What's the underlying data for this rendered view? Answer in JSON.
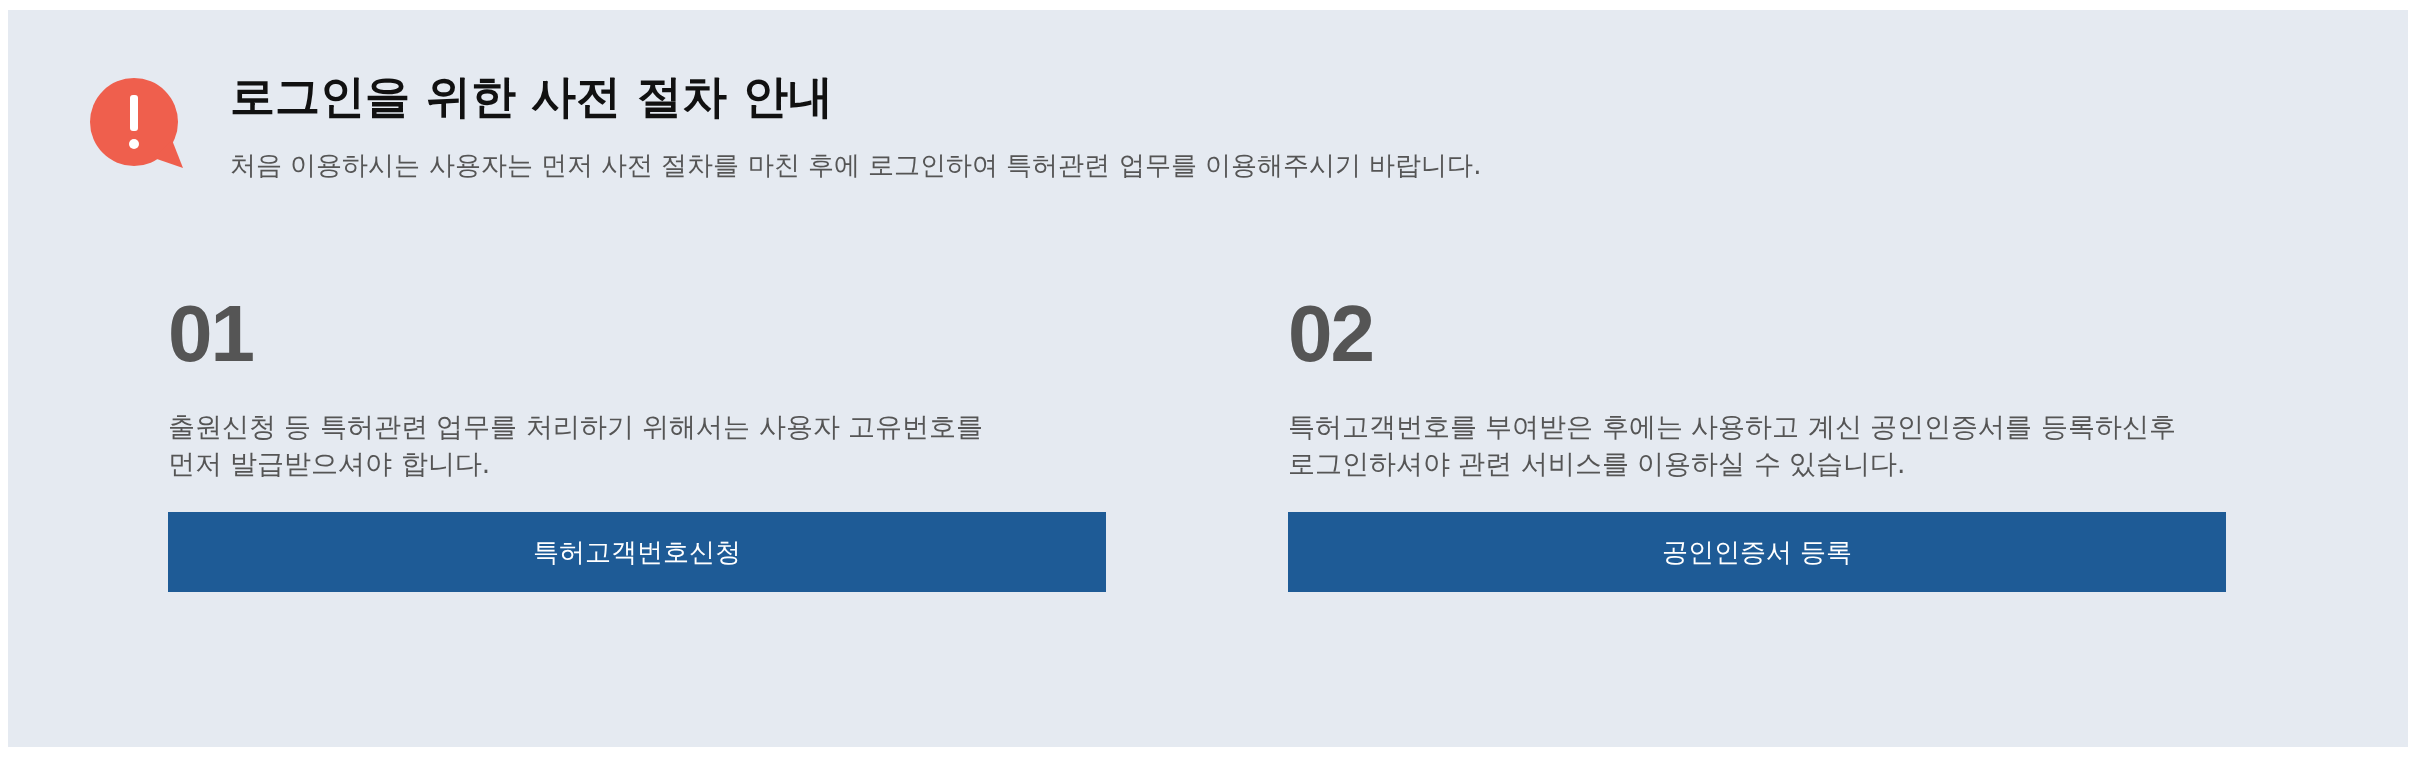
{
  "header": {
    "title": "로그인을 위한 사전 절차 안내",
    "subtitle": "처음 이용하시는 사용자는 먼저 사전 절차를 마친 후에 로그인하여 특허관련 업무를 이용해주시기 바랍니다."
  },
  "steps": [
    {
      "number": "01",
      "description": "출원신청 등 특허관련 업무를 처리하기 위해서는 사용자 고유번호를\n먼저 발급받으셔야 합니다.",
      "button": "특허고객번호신청"
    },
    {
      "number": "02",
      "description": "특허고객번호를 부여받은 후에는 사용하고 계신 공인인증서를 등록하신후\n로그인하셔야 관련 서비스를 이용하실 수 있습니다.",
      "button": "공인인증서 등록"
    }
  ]
}
